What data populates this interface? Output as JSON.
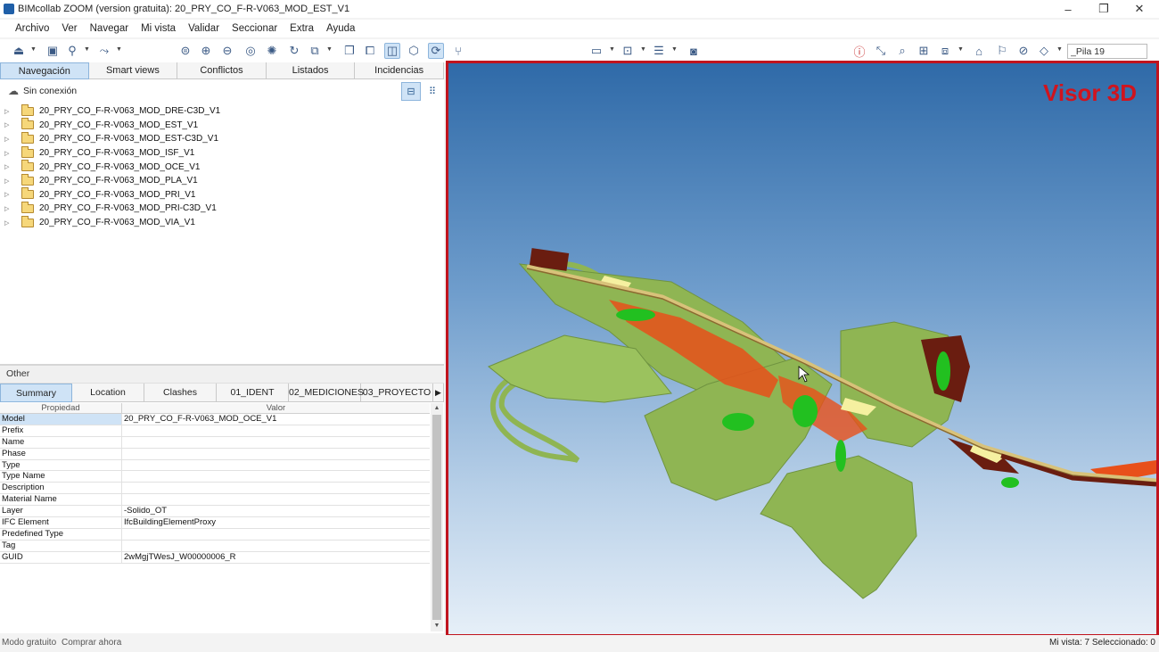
{
  "window": {
    "title": "BIMcollab ZOOM (version gratuita): 20_PRY_CO_F-R-V063_MOD_EST_V1",
    "minimize_glyph": "–",
    "maximize_glyph": "❐",
    "close_glyph": "✕"
  },
  "menu": [
    "Archivo",
    "Ver",
    "Navegar",
    "Mi vista",
    "Validar",
    "Seccionar",
    "Extra",
    "Ayuda"
  ],
  "toolbar": {
    "search_value": "_Pila 19"
  },
  "nav_tabs": [
    "Navegación",
    "Smart views",
    "Conflictos",
    "Listados",
    "Incidencias"
  ],
  "connection": {
    "icon": "cloud-icon",
    "status": "Sin conexión"
  },
  "tree_items": [
    "20_PRY_CO_F-R-V063_MOD_DRE-C3D_V1",
    "20_PRY_CO_F-R-V063_MOD_EST_V1",
    "20_PRY_CO_F-R-V063_MOD_EST-C3D_V1",
    "20_PRY_CO_F-R-V063_MOD_ISF_V1",
    "20_PRY_CO_F-R-V063_MOD_OCE_V1",
    "20_PRY_CO_F-R-V063_MOD_PLA_V1",
    "20_PRY_CO_F-R-V063_MOD_PRI_V1",
    "20_PRY_CO_F-R-V063_MOD_PRI-C3D_V1",
    "20_PRY_CO_F-R-V063_MOD_VIA_V1"
  ],
  "properties_section": "Other",
  "prop_tabs": [
    "Summary",
    "Location",
    "Clashes",
    "01_IDENT",
    "02_MEDICIONES",
    "03_PROYECTO"
  ],
  "prop_headers": {
    "property": "Propiedad",
    "value": "Valor"
  },
  "properties": [
    {
      "name": "Model",
      "value": "20_PRY_CO_F-R-V063_MOD_OCE_V1"
    },
    {
      "name": "Prefix",
      "value": ""
    },
    {
      "name": "Name",
      "value": ""
    },
    {
      "name": "Phase",
      "value": ""
    },
    {
      "name": "Type",
      "value": ""
    },
    {
      "name": "Type Name",
      "value": ""
    },
    {
      "name": "Description",
      "value": ""
    },
    {
      "name": "Material Name",
      "value": ""
    },
    {
      "name": "Layer",
      "value": "-Solido_OT"
    },
    {
      "name": "IFC Element",
      "value": "IfcBuildingElementProxy"
    },
    {
      "name": "Predefined Type",
      "value": ""
    },
    {
      "name": "Tag",
      "value": ""
    },
    {
      "name": "GUID",
      "value": "2wMgjTWesJ_W00000006_R"
    }
  ],
  "viewer": {
    "label": "Visor 3D",
    "border_color": "#c0141e"
  },
  "statusbar": {
    "mode": "Modo gratuito",
    "buy": "Comprar ahora",
    "right": "Mi vista: 7 Seleccionado: 0"
  },
  "colors": {
    "accent": "#cfe3f6",
    "terrain_green": "#8fb553",
    "bright_green": "#22c020",
    "orange": "#e8501a",
    "dark_brown": "#6a1d10"
  }
}
